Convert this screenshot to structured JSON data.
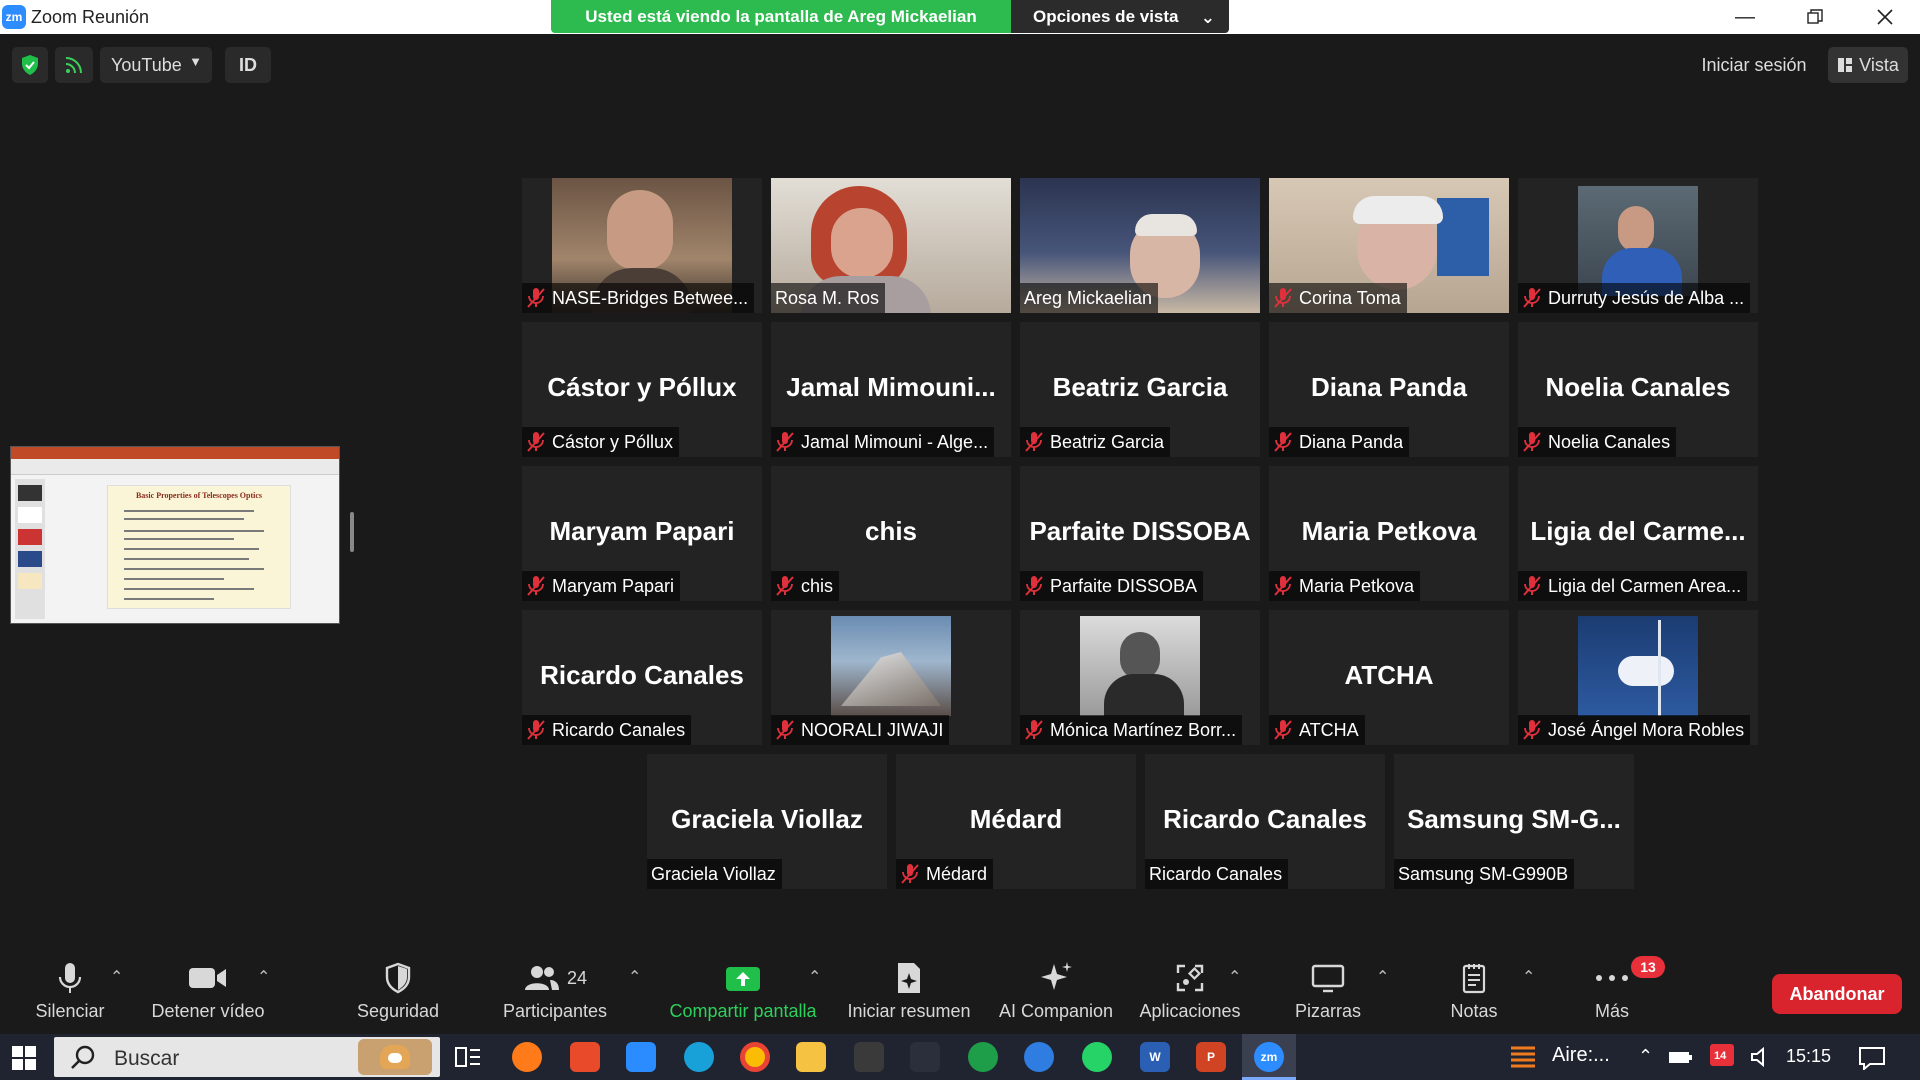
{
  "window": {
    "app_badge": "zm",
    "title": "Zoom Reunión",
    "share_banner": "Usted está viendo la pantalla de Areg Mickaelian",
    "view_options": "Opciones de vista"
  },
  "topbar": {
    "stream_label": "YouTube",
    "id_label": "ID",
    "signin": "Iniciar sesión",
    "view": "Vista"
  },
  "shared_slide": {
    "title": "Basic Properties of Telescopes Optics"
  },
  "participants": [
    {
      "display": "",
      "label": "NASE-Bridges Betwee...",
      "muted": true,
      "video": true
    },
    {
      "display": "",
      "label": "Rosa M. Ros",
      "muted": false,
      "video": true
    },
    {
      "display": "",
      "label": "Areg Mickaelian",
      "muted": false,
      "video": true,
      "active": true
    },
    {
      "display": "",
      "label": "Corina Toma",
      "muted": true,
      "video": true
    },
    {
      "display": "",
      "label": "Durruty Jesús de Alba ...",
      "muted": true,
      "video": true
    },
    {
      "display": "Cástor y Póllux",
      "label": "Cástor y Póllux",
      "muted": true
    },
    {
      "display": "Jamal  Mimouni...",
      "label": "Jamal Mimouni - Alge...",
      "muted": true
    },
    {
      "display": "Beatriz Garcia",
      "label": "Beatriz Garcia",
      "muted": true
    },
    {
      "display": "Diana Panda",
      "label": "Diana Panda",
      "muted": true
    },
    {
      "display": "Noelia Canales",
      "label": "Noelia Canales",
      "muted": true
    },
    {
      "display": "Maryam Papari",
      "label": "Maryam Papari",
      "muted": true
    },
    {
      "display": "chis",
      "label": "chis",
      "muted": true
    },
    {
      "display": "Parfaite DISSOBA",
      "label": "Parfaite DISSOBA",
      "muted": true
    },
    {
      "display": "Maria Petkova",
      "label": "Maria Petkova",
      "muted": true
    },
    {
      "display": "Ligia  del  Carme...",
      "label": "Ligia del Carmen Area...",
      "muted": true
    },
    {
      "display": "Ricardo Canales",
      "label": "Ricardo Canales",
      "muted": true
    },
    {
      "display": "",
      "label": "NOORALI JIWAJI",
      "muted": true,
      "photo": true
    },
    {
      "display": "",
      "label": "Mónica Martínez Borr...",
      "muted": true,
      "photo": true
    },
    {
      "display": "ATCHA",
      "label": "ATCHA",
      "muted": true
    },
    {
      "display": "",
      "label": "José Ángel Mora Robles",
      "muted": true,
      "photo": true
    },
    {
      "display": "Graciela Viollaz",
      "label": "Graciela Viollaz",
      "muted": false
    },
    {
      "display": "Médard",
      "label": "Médard",
      "muted": true
    },
    {
      "display": "Ricardo Canales",
      "label": "Ricardo Canales",
      "muted": false
    },
    {
      "display": "Samsung  SM-G...",
      "label": "Samsung SM-G990B",
      "muted": false
    }
  ],
  "controls": {
    "mute": "Silenciar",
    "video": "Detener vídeo",
    "security": "Seguridad",
    "participants_count": "24",
    "participants": "Participantes",
    "share": "Compartir pantalla",
    "summary": "Iniciar resumen",
    "ai": "AI Companion",
    "apps": "Aplicaciones",
    "whiteboards": "Pizarras",
    "notes": "Notas",
    "more": "Más",
    "more_badge": "13",
    "leave": "Abandonar"
  },
  "taskbar": {
    "search": "Buscar",
    "weather": "Aire:...",
    "time": "15:15",
    "calendar_badge": "14"
  },
  "colors": {
    "banner_green": "#2dba4e",
    "active_speaker": "#d7f04a",
    "leave_red": "#d9232d",
    "mic_off_red": "#e0303b"
  }
}
